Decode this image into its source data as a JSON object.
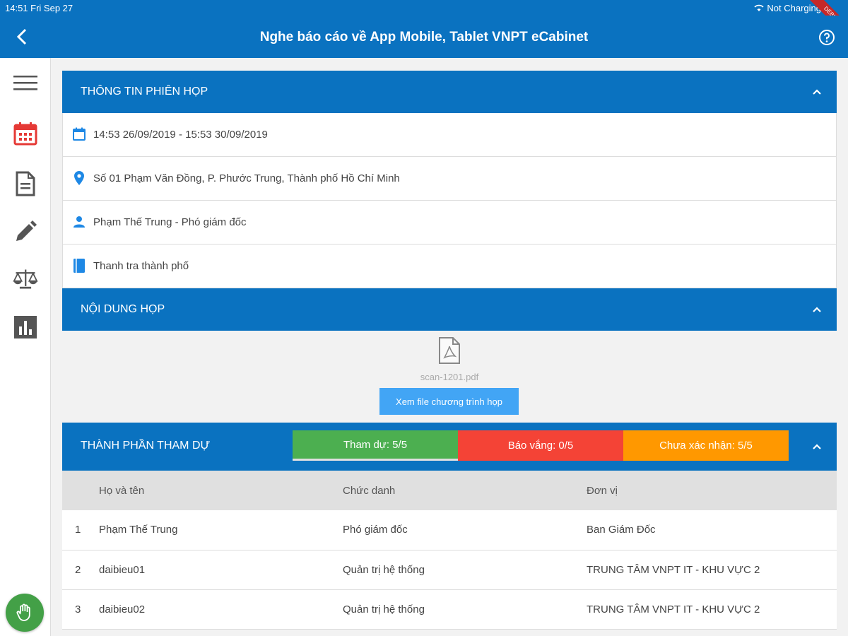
{
  "status_bar": {
    "time": "14:51  Fri Sep 27",
    "battery": "Not Charging",
    "ribbon": "DEBUG"
  },
  "header": {
    "title": "Nghe báo cáo về App Mobile, Tablet VNPT eCabinet"
  },
  "meeting_info": {
    "heading": "THÔNG TIN PHIÊN HỌP",
    "time": "14:53 26/09/2019 - 15:53 30/09/2019",
    "location": "Số 01 Phạm Văn Đồng, P. Phước Trung, Thành phố Hồ Chí Minh",
    "chair": "Phạm Thế Trung - Phó giám đốc",
    "organization": "Thanh tra thành phố"
  },
  "meeting_content": {
    "heading": "NỘI DUNG HỌP",
    "file_name": "scan-1201.pdf",
    "view_button": "Xem file chương trình họp"
  },
  "attendees": {
    "heading": "THÀNH PHẦN THAM DỰ",
    "tabs": [
      "Tham dự: 5/5",
      "Báo vắng: 0/5",
      "Chưa xác nhận: 5/5"
    ],
    "columns": [
      "Họ và tên",
      "Chức danh",
      "Đơn vị"
    ],
    "rows": [
      {
        "no": "1",
        "name": "Phạm Thế Trung",
        "role": "Phó giám đốc",
        "unit": "Ban Giám Đốc"
      },
      {
        "no": "2",
        "name": "daibieu01",
        "role": "Quản trị hệ thống",
        "unit": "TRUNG TÂM VNPT IT - KHU VỰC 2"
      },
      {
        "no": "3",
        "name": "daibieu02",
        "role": "Quản trị hệ thống",
        "unit": "TRUNG TÂM VNPT IT - KHU VỰC 2"
      }
    ]
  },
  "colors": {
    "primary": "#0a72c0",
    "attend": "#4caf50",
    "absent": "#f44336",
    "pending": "#ff9800",
    "calendar_active": "#e53935"
  },
  "sidebar_icons": [
    "menu-icon",
    "calendar-icon",
    "document-icon",
    "pen-icon",
    "scale-icon",
    "chart-icon",
    "hand-icon"
  ]
}
